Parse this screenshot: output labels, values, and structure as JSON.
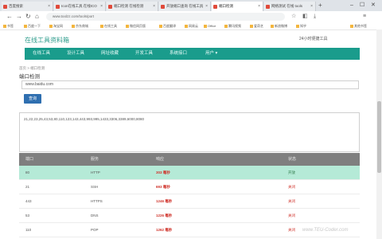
{
  "browser": {
    "tabs": [
      {
        "label": "百度搜索",
        "active": false
      },
      {
        "label": "Icon在线工具 在线ICO",
        "active": false
      },
      {
        "label": "端口检测 在线检测",
        "active": false
      },
      {
        "label": "开放端口查询 在线工具",
        "active": false
      },
      {
        "label": "端口检测",
        "active": true
      },
      {
        "label": "网络测试 在线 tools",
        "active": false
      }
    ],
    "url": "www.toolzz.com/tools/port",
    "bookmarks": [
      "书签",
      "百度一下",
      "淘宝网",
      "京东商城",
      "在线工具",
      "微信网页版",
      "百度翻译",
      "网易云",
      "Office",
      "腾讯视频",
      "爱奇艺",
      "新浪微博",
      "知乎",
      "其他书签"
    ]
  },
  "site": {
    "title": "在线工具资料箱",
    "hint": "24小时便捷工具",
    "menu": [
      "在线工具",
      "设计工具",
      "网址收藏",
      "开发工具",
      "系统接口",
      "用户 ▾"
    ]
  },
  "breadcrumb": "首页 > 端口检测",
  "page_title": "端口检测",
  "host_input": {
    "value": "www.baidu.com"
  },
  "query_button": "查询",
  "ports_textarea": "21,22,23,25,43,53,80,110,123,143,443,993,995,1433,3306,3389,6000,8080",
  "table": {
    "headers": [
      "端口",
      "服务",
      "响应",
      "状态"
    ],
    "rows": [
      {
        "port": "80",
        "service": "HTTP",
        "time": "303 毫秒",
        "status": "开放",
        "open": true
      },
      {
        "port": "21",
        "service": "SSH",
        "time": "693 毫秒",
        "status": "关闭",
        "open": false
      },
      {
        "port": "443",
        "service": "HTTPS",
        "time": "1246 毫秒",
        "status": "关闭",
        "open": false
      },
      {
        "port": "53",
        "service": "DNS",
        "time": "1226 毫秒",
        "status": "关闭",
        "open": false
      },
      {
        "port": "110",
        "service": "POP",
        "time": "1262 毫秒",
        "status": "关闭",
        "open": false
      }
    ]
  },
  "watermark": "www.TEU-Coder.com",
  "colors": {
    "accent": "#1a9c8c",
    "button": "#2f6fb0",
    "highlight_row": "#b5ead7",
    "error_text": "#d0342c",
    "table_header": "#7f7f7f"
  }
}
